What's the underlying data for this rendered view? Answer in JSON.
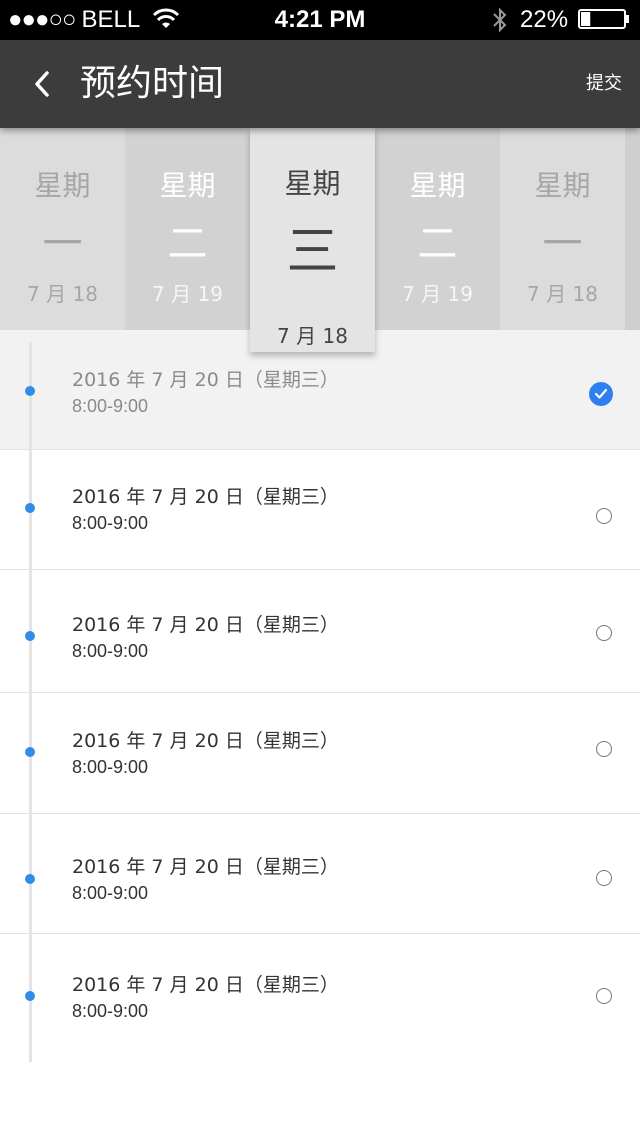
{
  "status_bar": {
    "carrier_dots": "●●●○○",
    "carrier": "BELL",
    "time": "4:21 PM",
    "battery_percent": "22%",
    "battery_level": 0.22,
    "icons": [
      "wifi-icon",
      "bluetooth-icon",
      "battery-icon"
    ]
  },
  "header": {
    "title": "预约时间",
    "submit_label": "提交",
    "back_icon": "chevron-left-icon"
  },
  "days": [
    {
      "week": "星期",
      "num": "一",
      "date": "7 月 18"
    },
    {
      "week": "星期",
      "num": "二",
      "date": "7 月 19"
    },
    {
      "week": "星期",
      "num": "三",
      "date": "7 月 18",
      "selected": true
    },
    {
      "week": "星期",
      "num": "二",
      "date": "7 月 19"
    },
    {
      "week": "星期",
      "num": "一",
      "date": "7 月 18"
    }
  ],
  "slots": [
    {
      "date": "2016 年 7 月 20 日（星期三）",
      "time": "8:00-9:00",
      "checked": true
    },
    {
      "date": "2016 年 7 月 20 日（星期三）",
      "time": "8:00-9:00",
      "checked": false
    },
    {
      "date": "2016 年 7 月 20 日（星期三）",
      "time": "8:00-9:00",
      "checked": false
    },
    {
      "date": "2016 年 7 月 20 日（星期三）",
      "time": "8:00-9:00",
      "checked": false
    },
    {
      "date": "2016 年 7 月 20 日（星期三）",
      "time": "8:00-9:00",
      "checked": false
    },
    {
      "date": "2016 年 7 月 20 日（星期三）",
      "time": "8:00-9:00",
      "checked": false
    }
  ],
  "colors": {
    "header_bg": "#3c3c3c",
    "accent_blue": "#2e7ff0",
    "timeline_dot": "#2f8de8"
  }
}
